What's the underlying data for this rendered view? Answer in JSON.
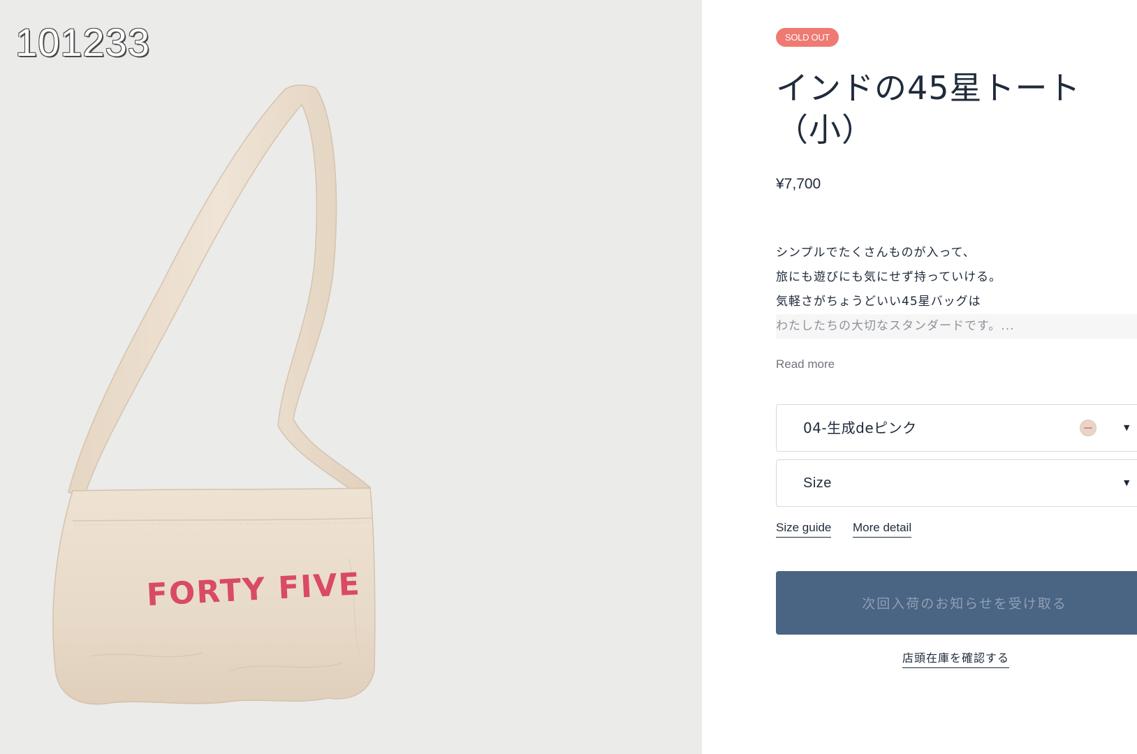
{
  "gallery": {
    "image_id": "101233",
    "bag_print": "FORTY FIVE"
  },
  "product": {
    "badge": "SOLD OUT",
    "title": "インドの45星トート（小）",
    "price": "¥7,700",
    "description": [
      "シンプルでたくさんものが入って、",
      "旅にも遊びにも気にせず持っていける。",
      "気軽さがちょうどいい45星バッグは",
      "わたしたちの大切なスタンダードです。..."
    ],
    "read_more": "Read more"
  },
  "options": {
    "color_value": "04-生成deピンク",
    "size_value": "Size"
  },
  "links": {
    "size_guide": "Size guide",
    "more_detail": "More detail"
  },
  "actions": {
    "notify_label": "次回入荷のお知らせを受け取る",
    "store_stock_label": "店頭在庫を確認する"
  },
  "colors": {
    "badge": "#ee7a72",
    "button": "#4a6483",
    "bag": "#eadccb",
    "print": "#d94a63"
  },
  "icons": {
    "dropdown": "caret-down-icon",
    "swatch": "color-swatch-icon"
  }
}
